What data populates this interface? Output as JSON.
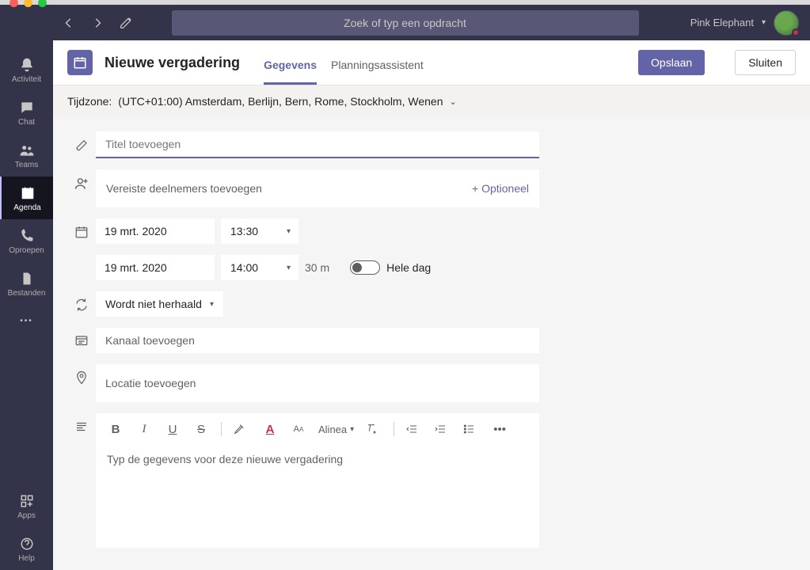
{
  "search": {
    "placeholder": "Zoek of typ een opdracht"
  },
  "user": {
    "name": "Pink Elephant"
  },
  "sidebar": {
    "items": [
      {
        "label": "Activiteit"
      },
      {
        "label": "Chat"
      },
      {
        "label": "Teams"
      },
      {
        "label": "Agenda"
      },
      {
        "label": "Oproepen"
      },
      {
        "label": "Bestanden"
      }
    ],
    "apps": "Apps",
    "help": "Help"
  },
  "meeting": {
    "page_title": "Nieuwe vergadering",
    "tabs": {
      "details": "Gegevens",
      "scheduling": "Planningsassistent"
    },
    "buttons": {
      "save": "Opslaan",
      "close": "Sluiten"
    },
    "timezone_label": "Tijdzone:",
    "timezone_value": "(UTC+01:00) Amsterdam, Berlijn, Bern, Rome, Stockholm, Wenen",
    "title_placeholder": "Titel toevoegen",
    "attendees_placeholder": "Vereiste deelnemers toevoegen",
    "optional_link": "+ Optioneel",
    "start_date": "19 mrt. 2020",
    "start_time": "13:30",
    "end_date": "19 mrt. 2020",
    "end_time": "14:00",
    "duration": "30 m",
    "allday_label": "Hele dag",
    "repeat": "Wordt niet herhaald",
    "channel_placeholder": "Kanaal toevoegen",
    "location_placeholder": "Locatie toevoegen",
    "rte_paragraph": "Alinea",
    "body_placeholder": "Typ de gegevens voor deze nieuwe vergadering"
  }
}
